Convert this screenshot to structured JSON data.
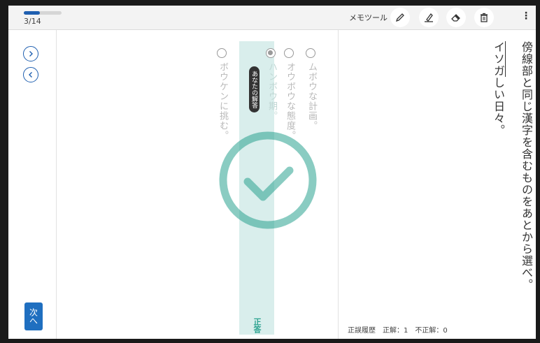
{
  "progress": {
    "text": "3/14",
    "fraction": 0.43
  },
  "toolbar": {
    "memo_label": "メモツール",
    "tools": [
      "pencil-icon",
      "marker-icon",
      "eraser-icon",
      "trash-icon"
    ],
    "more_icon": "⋮"
  },
  "nav": {
    "forward_icon": "chevron-right-icon",
    "back_icon": "chevron-left-icon",
    "next_label": "次へ"
  },
  "choices": [
    {
      "text": "ボウケンに挑む。",
      "selected": false
    },
    {
      "text": "ハンボウ期。",
      "selected": true
    },
    {
      "text": "オウボウな態度。",
      "selected": false
    },
    {
      "text": "ムボウな計画。",
      "selected": false
    }
  ],
  "your_answer_label": "あなたの解答",
  "correct_label": "正答",
  "question": {
    "prompt": "傍線部と同じ漢字を含むものをあとから選べ。",
    "sentence_underlined": "イソガ",
    "sentence_rest": "しい日々。"
  },
  "history": {
    "text": "正誤履歴　正解：1　不正解：0"
  },
  "colors": {
    "accent": "#1f5fb0",
    "correct": "#2aa28f",
    "highlight": "#d9eeec"
  }
}
